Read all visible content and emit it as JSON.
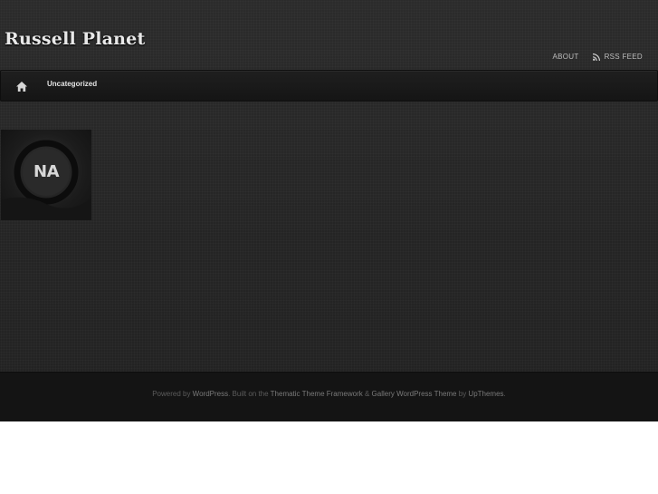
{
  "site": {
    "title": "Russell Planet"
  },
  "header": {
    "links": {
      "about": "ABOUT",
      "rss": "RSS FEED"
    }
  },
  "nav": {
    "home_icon": "home-icon",
    "items": [
      "Uncategorized"
    ]
  },
  "content": {
    "thumbnail_text": "NA"
  },
  "footer": {
    "powered_by": "Powered by ",
    "wordpress": "WordPress",
    "built_on": ". Built on the ",
    "thematic": "Thematic Theme Framework",
    "amp": " & ",
    "gallery": "Gallery WordPress Theme",
    "by": " by ",
    "upthemes": "UpThemes",
    "end": "."
  },
  "colors": {
    "background": "#262626",
    "nav_bar": "#181818",
    "footer": "#141414",
    "text": "#e4e4e4"
  }
}
